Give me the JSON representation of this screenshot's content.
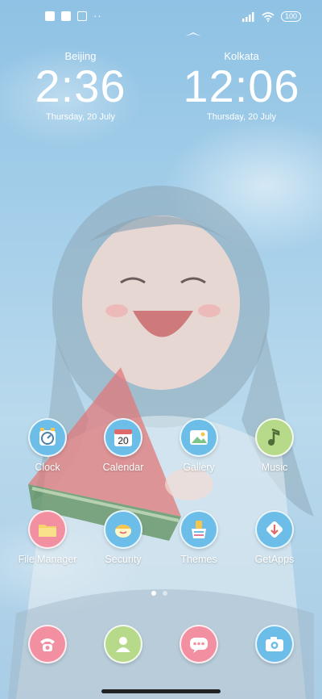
{
  "status_bar": {
    "battery": "100",
    "left_icons": [
      "notification-app-icon",
      "square-icon",
      "upload-icon"
    ],
    "overflow": "··"
  },
  "clocks": [
    {
      "city": "Beijing",
      "time": "2:36",
      "date": "Thursday, 20 July"
    },
    {
      "city": "Kolkata",
      "time": "12:06",
      "date": "Thursday, 20 July"
    }
  ],
  "apps_row1": [
    {
      "label": "Clock",
      "icon": "clock-icon",
      "color": "#6cbde8"
    },
    {
      "label": "Calendar",
      "icon": "calendar-icon",
      "color": "#6cbde8",
      "day": "20"
    },
    {
      "label": "Gallery",
      "icon": "gallery-icon",
      "color": "#6cbde8"
    },
    {
      "label": "Music",
      "icon": "music-icon",
      "color": "#b7d98a"
    }
  ],
  "apps_row2": [
    {
      "label": "File Manager",
      "icon": "folder-icon",
      "color": "#f28fa0"
    },
    {
      "label": "Security",
      "icon": "security-icon",
      "color": "#6cbde8"
    },
    {
      "label": "Themes",
      "icon": "themes-icon",
      "color": "#6cbde8"
    },
    {
      "label": "GetApps",
      "icon": "getapps-icon",
      "color": "#6cbde8"
    }
  ],
  "dock": [
    {
      "icon": "phone-icon",
      "color": "#f28fa0"
    },
    {
      "icon": "contacts-icon",
      "color": "#b7d98a"
    },
    {
      "icon": "messages-icon",
      "color": "#f28fa0"
    },
    {
      "icon": "camera-icon",
      "color": "#6cbde8"
    }
  ],
  "pages": {
    "current": 1,
    "total": 2
  }
}
